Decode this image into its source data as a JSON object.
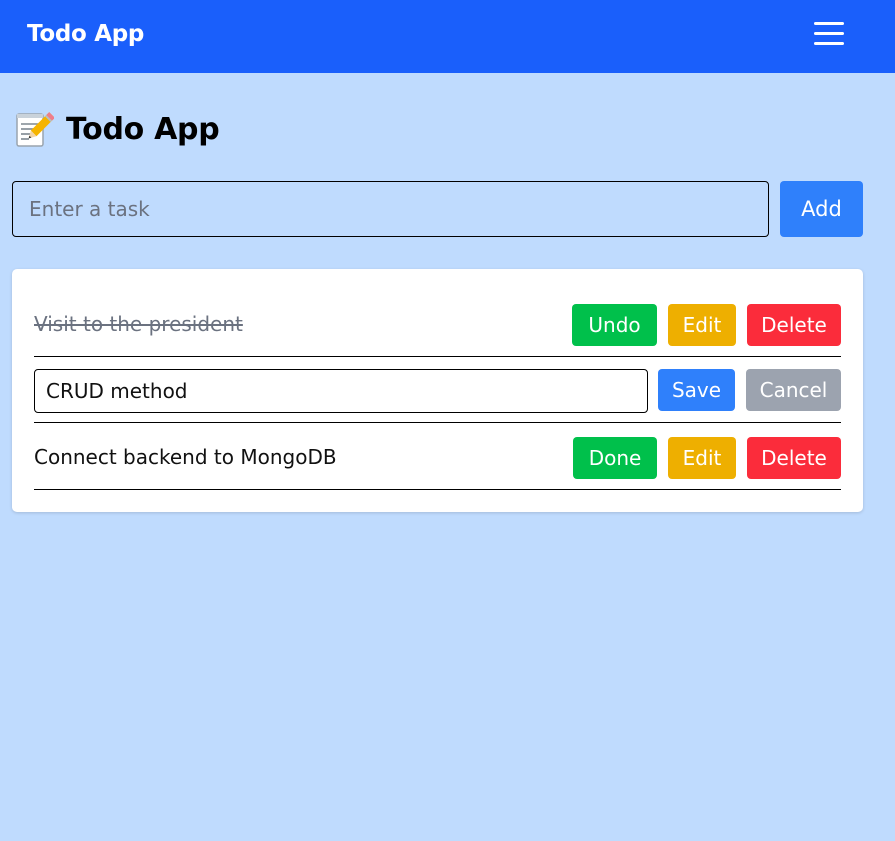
{
  "navbar": {
    "brand": "Todo App",
    "menu_icon": "hamburger-menu-icon"
  },
  "page": {
    "icon": "memo-icon",
    "title": "Todo App"
  },
  "new_task": {
    "placeholder": "Enter a task",
    "value": "",
    "add_label": "Add"
  },
  "todos": [
    {
      "text": "Visit to the president",
      "completed": true,
      "editing": false,
      "toggle_label": "Undo",
      "edit_label": "Edit",
      "delete_label": "Delete"
    },
    {
      "text": "CRUD method",
      "completed": false,
      "editing": true,
      "save_label": "Save",
      "cancel_label": "Cancel"
    },
    {
      "text": "Connect backend to MongoDB",
      "completed": false,
      "editing": false,
      "toggle_label": "Done",
      "edit_label": "Edit",
      "delete_label": "Delete"
    }
  ],
  "colors": {
    "navbar": "#1a5ffb",
    "background": "#bfdbfe",
    "primary": "#2f80fb",
    "success": "#00c04b",
    "warning": "#eeaf00",
    "danger": "#fb2c3b",
    "secondary": "#9ca3af"
  }
}
